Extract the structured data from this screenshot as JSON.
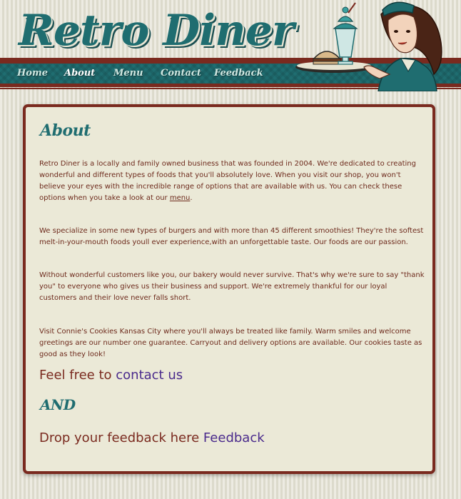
{
  "site": {
    "logo": "Retro Diner"
  },
  "nav": {
    "items": [
      {
        "label": "Home"
      },
      {
        "label": "About"
      },
      {
        "label": "Menu"
      },
      {
        "label": "Contact"
      },
      {
        "label": "Feedback"
      }
    ]
  },
  "main": {
    "title": "About",
    "p1": {
      "text": "Retro Diner is a locally and family owned business that was founded in 2004. We're dedicated to creating wonderful and different types of foods that you'll absolutely love. When you visit our shop, you won't believe your eyes with the incredible range of options that are available with us. You can check these options when you take a look at our ",
      "link": "menu",
      "end": "."
    },
    "p2": "We specialize in some new types of burgers and with more than 45 different smoothies! They're the softest melt-in-your-mouth foods youll ever experience,with an unforgettable taste. Our foods are our passion.",
    "p3": "Without wonderful customers like you, our bakery would never survive. That's why we're sure to say \"thank you\" to everyone who gives us their business and support. We're extremely thankful for our loyal customers and their love never falls short.",
    "p4": "Visit Connie's Cookies Kansas City where you'll always be treated like family. Warm smiles and welcome greetings are our number one guarantee. Carryout and delivery options are available. Our cookies taste as good as they look!",
    "contact_line": {
      "prefix": "Feel free to ",
      "link": "contact us"
    },
    "and": "AND",
    "feedback_line": {
      "prefix": "Drop your feedback here ",
      "link": "Feedback"
    }
  },
  "colors": {
    "teal": "#1f6d70",
    "maroon": "#7a2a1f",
    "panel": "#ebe9d7",
    "link_purple": "#4a2a8c"
  }
}
